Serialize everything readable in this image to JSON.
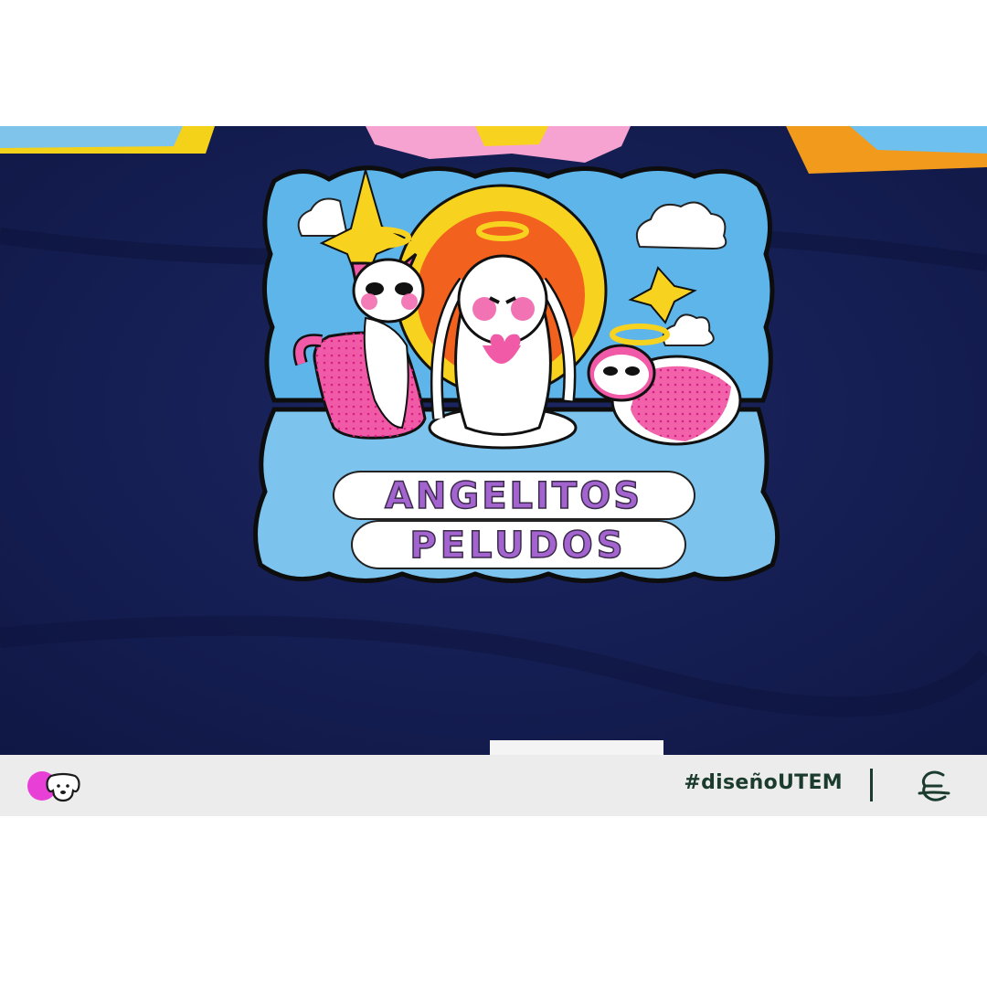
{
  "photo": {
    "subject": "pop-up paper craft on navy tablecloth",
    "title_line1": "ANGELITOS",
    "title_line2": "PELUDOS"
  },
  "footer": {
    "hashtag": "#diseñoUTEM",
    "left_icon": "dog-face-icon",
    "right_icon": "utem-logo-icon",
    "accent_color": "#e83fd6",
    "text_color": "#1b3b2e"
  }
}
